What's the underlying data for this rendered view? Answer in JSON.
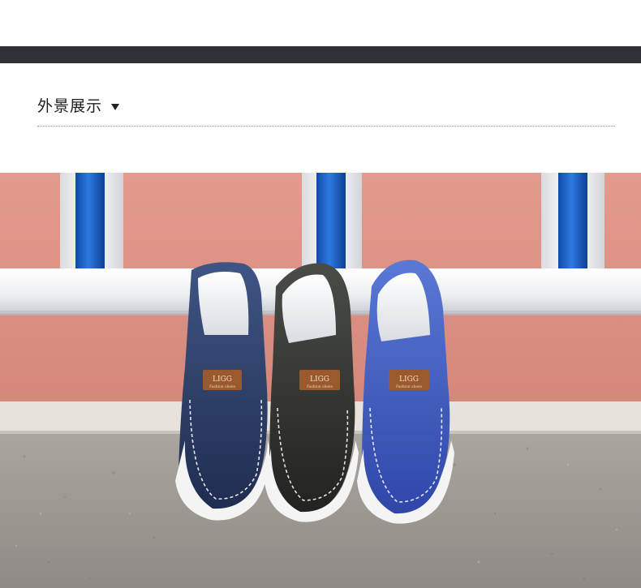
{
  "header": {
    "title": "外景展示",
    "toggle_icon": "triangle-down-icon"
  },
  "photo": {
    "subject": "three slip-on denim loafers on asphalt in front of a railing",
    "shoes": [
      {
        "color": "#2c3c64",
        "label_brand": "LIGG",
        "label_sub": "Fashion shoes"
      },
      {
        "color": "#2f302c",
        "label_brand": "LIGG",
        "label_sub": "Fashion shoes"
      },
      {
        "color": "#3b55b8",
        "label_brand": "LIGG",
        "label_sub": "Fashion shoes"
      }
    ]
  },
  "colors": {
    "top_bar": "#2e3138",
    "track": "#d98c7f",
    "railing_blue": "#1c5fc4",
    "railing_white": "#f2f3f5",
    "asphalt": "#9a9590"
  }
}
